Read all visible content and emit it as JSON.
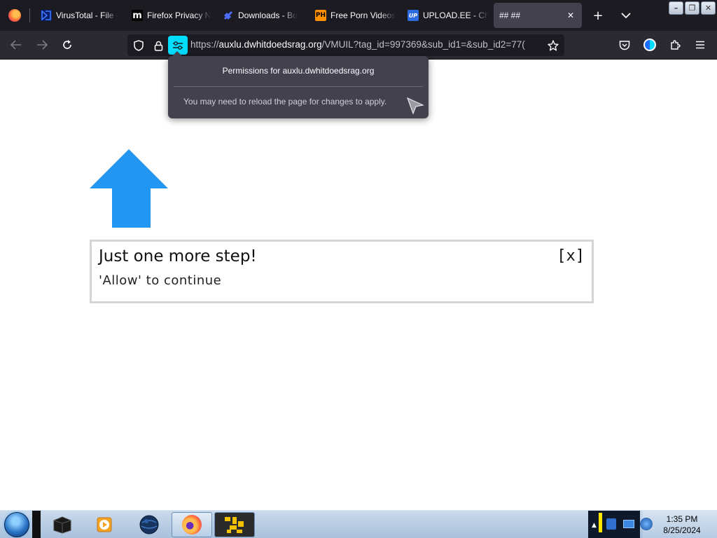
{
  "browser": {
    "tabs": [
      {
        "label": "VirusTotal - File -",
        "icon": "virustotal-icon",
        "icon_color": "#394eff"
      },
      {
        "label": "Firefox Privacy N",
        "icon": "mozilla-m-icon",
        "icon_color": "#000000"
      },
      {
        "label": "Downloads - Bo",
        "icon": "puzzle-icon",
        "icon_color": "#4a6cf7"
      },
      {
        "label": "Free Porn Videos",
        "icon": "ph-icon",
        "icon_color": "#ff9000"
      },
      {
        "label": "UPLOAD.EE - Ch",
        "icon": "upload-ee-icon",
        "icon_color": "#2d6be0"
      },
      {
        "label": "## ##",
        "icon": "",
        "icon_color": "",
        "active": true
      }
    ],
    "tab_icon_text": {
      "ph": "PH",
      "mozilla": "m",
      "upload": "UP"
    },
    "url": {
      "prefix": "https://",
      "host": "auxlu.dwhitdoedsrag.org",
      "path": "/VMUIL?tag_id=997369&sub_id1=&sub_id2=77("
    },
    "window_buttons": {
      "minimize": "–",
      "restore": "❐",
      "close": "✕"
    }
  },
  "popup": {
    "title": "Permissions for auxlu.dwhitdoedsrag.org",
    "message": "You may need to reload the page for changes to apply."
  },
  "page": {
    "title": "Just one more step!",
    "subtitle": "'Allow' to continue",
    "close_label": "[x]",
    "arrow_color": "#2196f3"
  },
  "taskbar": {
    "time": "1:35 PM",
    "date": "8/25/2024"
  },
  "colors": {
    "accent": "#00ddff",
    "tabstrip_bg": "#1c1b22",
    "toolbar_bg": "#2b2a33",
    "popup_bg": "#42414d"
  }
}
